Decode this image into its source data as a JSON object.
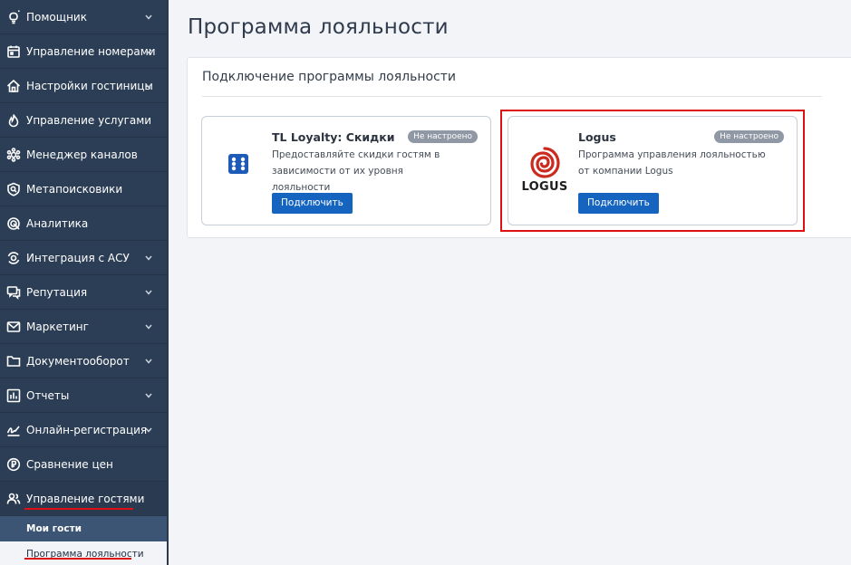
{
  "sidebar": {
    "items": [
      {
        "label": "Помощник",
        "icon": "lightbulb-icon"
      },
      {
        "label": "Управление номерами",
        "icon": "calendar-icon"
      },
      {
        "label": "Настройки гостиницы",
        "icon": "house-icon"
      },
      {
        "label": "Управление услугами",
        "icon": "flame-icon"
      },
      {
        "label": "Менеджер каналов",
        "icon": "gear-network-icon"
      },
      {
        "label": "Метапоисковики",
        "icon": "search-shield-icon"
      },
      {
        "label": "Аналитика",
        "icon": "target-icon"
      },
      {
        "label": "Интеграция с АСУ",
        "icon": "refresh-target-icon"
      },
      {
        "label": "Репутация",
        "icon": "chat-icon"
      },
      {
        "label": "Маркетинг",
        "icon": "envelope-icon"
      },
      {
        "label": "Документооборот",
        "icon": "folder-icon"
      },
      {
        "label": "Отчеты",
        "icon": "bar-chart-icon"
      },
      {
        "label": "Онлайн-регистрация",
        "icon": "signature-icon"
      },
      {
        "label": "Сравнение цен",
        "icon": "price-compare-icon"
      },
      {
        "label": "Управление гостями",
        "icon": "users-icon"
      }
    ],
    "sub_items": [
      {
        "label": "Мои гости"
      },
      {
        "label": "Программа лояльности"
      }
    ]
  },
  "page": {
    "title": "Программа лояльности",
    "panel_title": "Подключение программы лояльности"
  },
  "cards": [
    {
      "name": "TL Loyalty: Скидки",
      "badge": "Не настроено",
      "description": "Предоставляйте скидки гостям в зависимости от их уровня лояльности",
      "button": "Подключить"
    },
    {
      "name": "Logus",
      "badge": "Не настроено",
      "description": "Программа управления лояльностью от компании Logus",
      "button": "Подключить",
      "logo_text": "LOGUS"
    }
  ],
  "colors": {
    "sidebar_bg": "#2c3e55",
    "primary_button": "#1565c0",
    "badge_bg": "#8f98a4",
    "highlight": "#dd1111",
    "logus_red": "#cc2a1e"
  }
}
